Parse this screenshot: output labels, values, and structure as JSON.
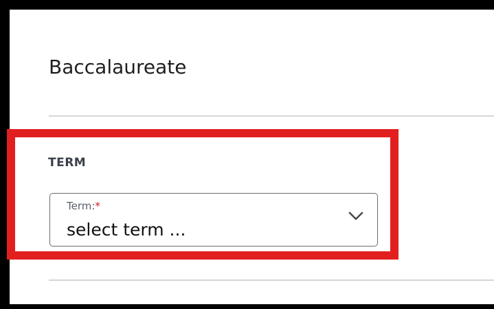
{
  "page": {
    "title": "Baccalaureate"
  },
  "term_section": {
    "heading": "TERM",
    "select": {
      "label": "Term:",
      "required_marker": "*",
      "value": "select term ..."
    }
  },
  "colors": {
    "highlight": "#e11f1f",
    "required": "#d01818",
    "frame": "#000000"
  },
  "icons": {
    "dropdown": "chevron-down-icon"
  }
}
